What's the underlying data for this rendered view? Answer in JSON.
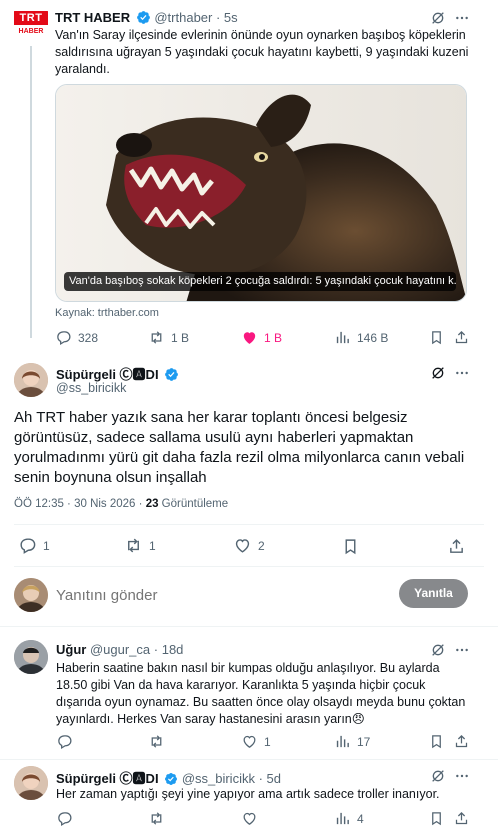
{
  "quoted": {
    "name": "TRT HABER",
    "handle": "@trthaber",
    "time": "· 5s",
    "avatar_text_top": "TRT",
    "avatar_text_bottom": "HABER",
    "text": "Van'ın Saray ilçesinde evlerinin önünde oyun oynarken başıboş köpeklerin saldırısına uğrayan 5 yaşındaki çocuk hayatını kaybetti, 9 yaşındaki kuzeni yaralandı.",
    "image_caption": "Van'da başıboş sokak köpekleri 2 çocuğa saldırdı: 5 yaşındaki çocuk hayatını k...",
    "source": "Kaynak: trthaber.com",
    "stats": {
      "replies": "328",
      "retweets": "1 B",
      "likes": "1 B",
      "views": "146 B"
    }
  },
  "main": {
    "name": "Süpürgeli Ⓒ🅰DI",
    "handle": "@ss_biricikk",
    "text": "Ah TRT haber yazık sana her karar toplantı öncesi belgesiz görüntüsüz, sadece sallama usulü aynı haberleri yapmaktan yorulmadınmı yürü git daha fazla rezil olma milyonlarca canın vebali senin boynuna olsun inşallah",
    "timestamp": "ÖÖ 12:35 · 30 Nis 2026 · ",
    "views_count": "23",
    "views_label": " Görüntüleme",
    "stats": {
      "replies": "1",
      "retweets": "1",
      "likes": "2"
    }
  },
  "composer": {
    "placeholder": "Yanıtını gönder",
    "button": "Yanıtla"
  },
  "replies": [
    {
      "name": "Uğur",
      "handle": "@ugur_ca",
      "time": "· 18d",
      "text": "Haberin saatine bakın nasıl bir kumpas olduğu anlaşılıyor. Bu aylarda 18.50 gibi Van da  hava kararıyor. Karanlıkta 5 yaşında hiçbir çocuk dışarıda oyun oynamaz. Bu saatten önce olay olsaydı meyda bunu çoktan yayınlardı. Herkes Van saray hastanesini arasın yarın😠",
      "stats": {
        "replies": "",
        "retweets": "",
        "likes": "1",
        "views": "17"
      }
    },
    {
      "name": "Süpürgeli Ⓒ🅰DI",
      "handle": "@ss_biricikk",
      "time": "· 5d",
      "text": "Her zaman yaptığı şeyi yine yapıyor ama artık sadece troller inanıyor.",
      "stats": {
        "replies": "",
        "retweets": "",
        "likes": "",
        "views": "4"
      }
    }
  ],
  "colors": {
    "accent": "#1d9bf0",
    "like": "#f91880",
    "trt_red": "#e30a17",
    "button_disabled": "#87898c"
  }
}
